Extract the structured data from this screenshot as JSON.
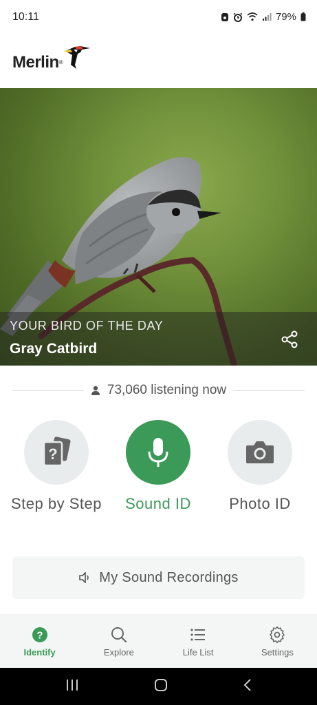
{
  "status_bar": {
    "time": "10:11",
    "battery": "79%"
  },
  "header": {
    "logo_text": "Merlin",
    "trademark": "®"
  },
  "hero": {
    "caption": "YOUR BIRD OF THE DAY",
    "bird_name": "Gray Catbird"
  },
  "listening": {
    "text": "73,060 listening now"
  },
  "actions": [
    {
      "label": "Step by Step",
      "icon": "cards-question-icon"
    },
    {
      "label": "Sound ID",
      "icon": "microphone-icon"
    },
    {
      "label": "Photo ID",
      "icon": "camera-icon"
    }
  ],
  "recordings": {
    "label": "My Sound Recordings"
  },
  "bottom_nav": [
    {
      "label": "Identify",
      "icon": "question-circle-icon",
      "active": true
    },
    {
      "label": "Explore",
      "icon": "search-icon",
      "active": false
    },
    {
      "label": "Life List",
      "icon": "list-icon",
      "active": false
    },
    {
      "label": "Settings",
      "icon": "gear-icon",
      "active": false
    }
  ],
  "colors": {
    "accent": "#3b9a57",
    "grey_button": "#e9ecec",
    "nav_background": "#f4f6f6"
  }
}
